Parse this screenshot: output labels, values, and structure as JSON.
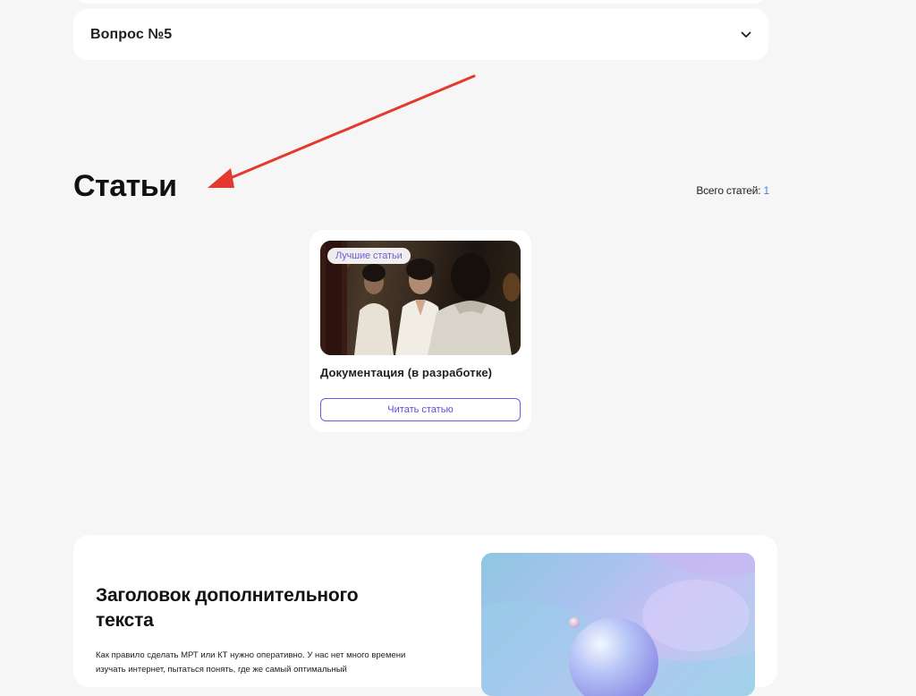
{
  "faq": {
    "question_title": "Вопрос №5"
  },
  "articles": {
    "section_title": "Статьи",
    "total_label": "Всего статей:",
    "total_count": "1",
    "items": [
      {
        "badge": "Лучшие статьи",
        "title": "Документация (в разработке)",
        "button_label": "Читать статью"
      }
    ]
  },
  "extra": {
    "heading": "Заголовок дополнительного текста",
    "body": "Как правило сделать МРТ или КТ нужно оперативно. У нас нет много времени изучать интернет, пытаться понять, где же самый оптимальный"
  },
  "annotation": {
    "arrow_color": "#e23b2e"
  },
  "colors": {
    "accent": "#6a5ee0",
    "count_link": "#4a7fd8",
    "page_bg": "#f6f6f6"
  }
}
